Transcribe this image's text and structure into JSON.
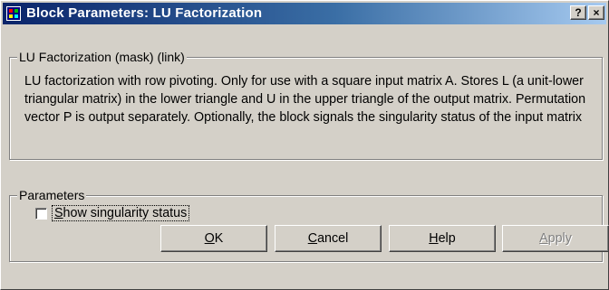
{
  "window": {
    "title": "Block Parameters: LU Factorization",
    "help_glyph": "?",
    "close_glyph": "×",
    "icon": "block-diagram-icon"
  },
  "mask": {
    "legend": "LU Factorization (mask) (link)",
    "description": "LU factorization with row pivoting.  Only for use with a square input matrix A.  Stores L (a unit-lower triangular matrix) in the lower triangle and U in the upper triangle of the output matrix.  Permutation vector P is output separately.  Optionally, the block signals the singularity status of the input matrix"
  },
  "parameters": {
    "legend": "Parameters",
    "show_singularity": {
      "label": "Show singularity status",
      "checked": false
    }
  },
  "buttons": {
    "ok": "OK",
    "cancel": "Cancel",
    "help": "Help",
    "apply": "Apply"
  },
  "colors": {
    "title_gradient_start": "#0a246a",
    "title_gradient_end": "#a6caf0",
    "face": "#d4d0c8"
  }
}
